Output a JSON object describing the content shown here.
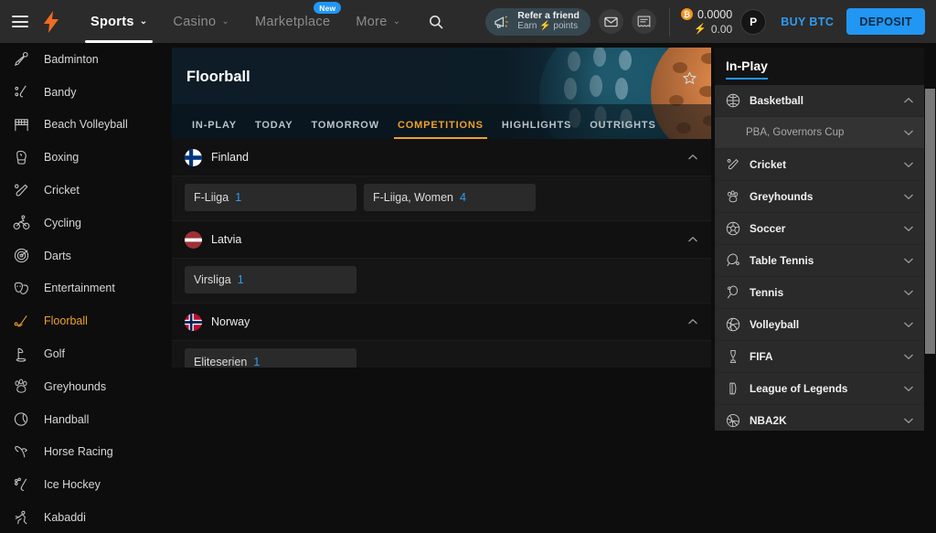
{
  "topbar": {
    "menu_icon": "hamburger-icon",
    "logo_icon": "lightning-bolt-logo",
    "nav": [
      {
        "label": "Sports",
        "caret": "⌄",
        "active": true,
        "badge": null
      },
      {
        "label": "Casino",
        "caret": "⌄",
        "active": false,
        "badge": null
      },
      {
        "label": "Marketplace",
        "caret": "",
        "active": false,
        "badge": "New"
      },
      {
        "label": "More",
        "caret": "⌄",
        "active": false,
        "badge": null
      }
    ],
    "search_icon": "search-icon",
    "refer": {
      "title": "Refer a friend",
      "subtitle": "Earn ⚡ points",
      "icon": "megaphone-icon"
    },
    "mail_icon": "envelope-icon",
    "notes_icon": "bet-slip-icon",
    "balance": {
      "coin_symbol": "₿",
      "primary": "0.0000",
      "bolt_symbol": "⚡",
      "secondary": "0.00"
    },
    "avatar_initial": "P",
    "buy_btc_label": "BUY BTC",
    "deposit_label": "DEPOSIT",
    "accent_blue": "#2196f3",
    "accent_orange": "#f0a02a"
  },
  "sidebar": {
    "items": [
      {
        "label": "Badminton",
        "icon": "shuttlecock-icon",
        "active": false
      },
      {
        "label": "Bandy",
        "icon": "bandy-stick-icon",
        "active": false
      },
      {
        "label": "Beach Volleyball",
        "icon": "volleyball-net-icon",
        "active": false
      },
      {
        "label": "Boxing",
        "icon": "boxing-glove-icon",
        "active": false
      },
      {
        "label": "Cricket",
        "icon": "cricket-bat-icon",
        "active": false
      },
      {
        "label": "Cycling",
        "icon": "cyclist-icon",
        "active": false
      },
      {
        "label": "Darts",
        "icon": "dartboard-icon",
        "active": false
      },
      {
        "label": "Entertainment",
        "icon": "masks-icon",
        "active": false
      },
      {
        "label": "Floorball",
        "icon": "floorball-stick-icon",
        "active": true
      },
      {
        "label": "Golf",
        "icon": "golf-flag-icon",
        "active": false
      },
      {
        "label": "Greyhounds",
        "icon": "paw-print-icon",
        "active": false
      },
      {
        "label": "Handball",
        "icon": "handball-icon",
        "active": false
      },
      {
        "label": "Horse Racing",
        "icon": "horse-icon",
        "active": false
      },
      {
        "label": "Ice Hockey",
        "icon": "hockey-stick-icon",
        "active": false
      },
      {
        "label": "Kabaddi",
        "icon": "kabaddi-icon",
        "active": false
      }
    ]
  },
  "main": {
    "hero_title": "Floorball",
    "favorite_icon": "star-outline-icon",
    "tabs": [
      {
        "label": "IN-PLAY",
        "active": false
      },
      {
        "label": "TODAY",
        "active": false
      },
      {
        "label": "TOMORROW",
        "active": false
      },
      {
        "label": "COMPETITIONS",
        "active": true
      },
      {
        "label": "HIGHLIGHTS",
        "active": false
      },
      {
        "label": "OUTRIGHTS",
        "active": false
      }
    ],
    "countries": [
      {
        "name": "Finland",
        "flag": "flag-finland",
        "expanded": true,
        "chevron": "chevron-up-icon",
        "competitions": [
          {
            "name": "F-Liiga",
            "count": "1"
          },
          {
            "name": "F-Liiga, Women",
            "count": "4"
          }
        ]
      },
      {
        "name": "Latvia",
        "flag": "flag-latvia",
        "expanded": true,
        "chevron": "chevron-up-icon",
        "competitions": [
          {
            "name": "Virsliga",
            "count": "1"
          }
        ]
      },
      {
        "name": "Norway",
        "flag": "flag-norway",
        "expanded": true,
        "chevron": "chevron-up-icon",
        "competitions": [
          {
            "name": "Eliteserien",
            "count": "1"
          }
        ]
      }
    ]
  },
  "rightpanel": {
    "title": "In-Play",
    "rows": [
      {
        "label": "Basketball",
        "icon": "basketball-icon",
        "chevron": "chevron-up-icon",
        "sub": false
      },
      {
        "label": "PBA, Governors Cup",
        "icon": "",
        "chevron": "chevron-down-icon",
        "sub": true
      },
      {
        "label": "Cricket",
        "icon": "cricket-bat-icon",
        "chevron": "chevron-down-icon",
        "sub": false
      },
      {
        "label": "Greyhounds",
        "icon": "paw-print-icon",
        "chevron": "chevron-down-icon",
        "sub": false
      },
      {
        "label": "Soccer",
        "icon": "soccer-ball-icon",
        "chevron": "chevron-down-icon",
        "sub": false
      },
      {
        "label": "Table Tennis",
        "icon": "table-tennis-paddle-icon",
        "chevron": "chevron-down-icon",
        "sub": false
      },
      {
        "label": "Tennis",
        "icon": "tennis-racket-icon",
        "chevron": "chevron-down-icon",
        "sub": false
      },
      {
        "label": "Volleyball",
        "icon": "volleyball-icon",
        "chevron": "chevron-down-icon",
        "sub": false
      },
      {
        "label": "FIFA",
        "icon": "trophy-icon",
        "chevron": "chevron-down-icon",
        "sub": false
      },
      {
        "label": "League of Legends",
        "icon": "lol-icon",
        "chevron": "chevron-down-icon",
        "sub": false
      },
      {
        "label": "NBA2K",
        "icon": "nba2k-icon",
        "chevron": "chevron-down-icon",
        "sub": false
      }
    ]
  }
}
